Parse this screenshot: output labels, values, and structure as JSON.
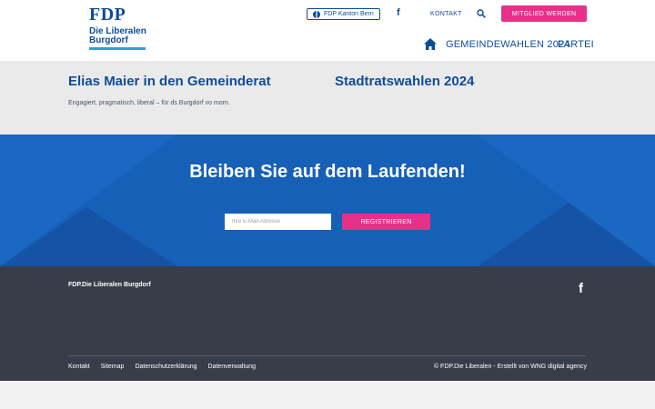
{
  "header": {
    "logo": {
      "brand": "FDP",
      "line1": "Die Liberalen",
      "line2": "Burgdorf"
    },
    "kanton_link": "FDP Kanton Bern",
    "facebook_glyph": "f",
    "kontakt": "KONTAKT",
    "mitglied_button": "MITGLIED WERDEN",
    "nav": [
      "GEMEINDEWAHLEN 2024",
      "PARTEI"
    ],
    "icons": [
      "globe-icon",
      "facebook-icon",
      "search-icon",
      "home-icon"
    ]
  },
  "posts": [
    {
      "title": "Elias Maier in den Gemeinderat",
      "subtitle": "Engagiert, pragmatisch, liberal – für ds Burgdorf vo morn."
    },
    {
      "title": "Stadtratswahlen 2024"
    }
  ],
  "newsletter": {
    "title": "Bleiben Sie auf dem Laufenden!",
    "email_placeholder": "Ihre E-Mail-Adresse",
    "email_value": "",
    "register_button": "REGISTRIEREN"
  },
  "footer": {
    "org": "FDP.Die Liberalen Burgdorf",
    "facebook_glyph": "f",
    "links": [
      "Kontakt",
      "Sitemap",
      "Datenschutzerklärung",
      "Datenverwaltung"
    ],
    "copyright": "© FDP.Die Liberalen - Erstellt von WNG digital agency"
  },
  "colors": {
    "primary": "#0e4c9a",
    "accent": "#e6308a",
    "newsletter_bg": "#1760b8",
    "footer_bg": "#383d4a"
  }
}
